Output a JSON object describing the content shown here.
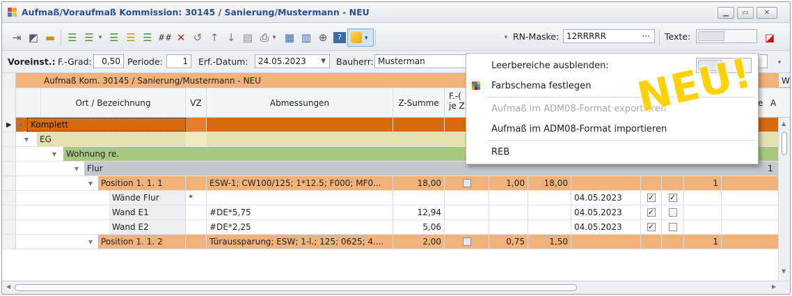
{
  "window": {
    "title": "Aufmaß/Voraufmaß Kommission: 30145 / Sanierung/Mustermann - NEU"
  },
  "toolbar": {
    "rn_label": "RN-Maske:",
    "rn_value": "12RRRRR",
    "rn_more": "···",
    "texte_label": "Texte:"
  },
  "settings": {
    "voreinst_label": "Voreinst.:",
    "fgrad_label": "F.-Grad:",
    "fgrad_value": "0,50",
    "periode_label": "Periode:",
    "periode_value": "1",
    "erf_label": "Erf.-Datum:",
    "erf_value": "24.05.2023",
    "bauherr_label": "Bauherr:",
    "bauherr_value": "Musterman"
  },
  "grid": {
    "group_header": "Aufmaß Kom. 30145 / Sanierung/Mustermann - NEU",
    "group_header_cut": "W",
    "columns": {
      "ort": "Ort / Bezeichnung",
      "vz": "VZ",
      "abm": "Abmessungen",
      "zsum": "Z-Summe",
      "f1": "F.-(",
      "f2": "je Z",
      "e_cut": "e",
      "a_cut": "A"
    },
    "rows": [
      {
        "label": "Komplett",
        "vz": "",
        "abm": "",
        "zsum": "",
        "c1": "",
        "c2": "",
        "date": "",
        "v": ""
      },
      {
        "label": "EG"
      },
      {
        "label": "Wohnung re."
      },
      {
        "label": "Flur",
        "tail": "1"
      },
      {
        "label": "Position  1. 1.  1",
        "abm": "ESW-1; CW100/125; 1*12.5; F000; MF0...",
        "zsum": "18,00",
        "c1": "1,00",
        "c2": "18,00",
        "v": "1"
      },
      {
        "label": "Wände Flur",
        "vz": "*",
        "date": "04.05.2023"
      },
      {
        "label": "Wand E1",
        "abm": "#DE*5,75",
        "zsum": "12,94",
        "date": "04.05.2023"
      },
      {
        "label": "Wand E2",
        "abm": "#DE*2,25",
        "zsum": "5,06",
        "date": "04.05.2023"
      },
      {
        "label": "Position  1. 1.  2",
        "abm": "Türaussparung; ESW; 1-l.; 125; 0625; 4....",
        "zsum": "2,00",
        "c1": "0,75",
        "c2": "1,50",
        "v": "1"
      }
    ]
  },
  "menu": {
    "item1": "Leerbereiche ausblenden:",
    "item2": "Farbschema festlegen",
    "item3": "Aufmaß im ADM08-Format exportieren",
    "item4": "Aufmaß im ADM08-Format importieren",
    "item5": "REB"
  },
  "badge": "NEU!",
  "colors": {
    "position": "#f2b37a",
    "komplett": "#d56a0e",
    "eg": "#e4e1b0",
    "wohnung": "#a6c97f",
    "flur": "#c5c8cd",
    "header": "#f2b37a"
  }
}
